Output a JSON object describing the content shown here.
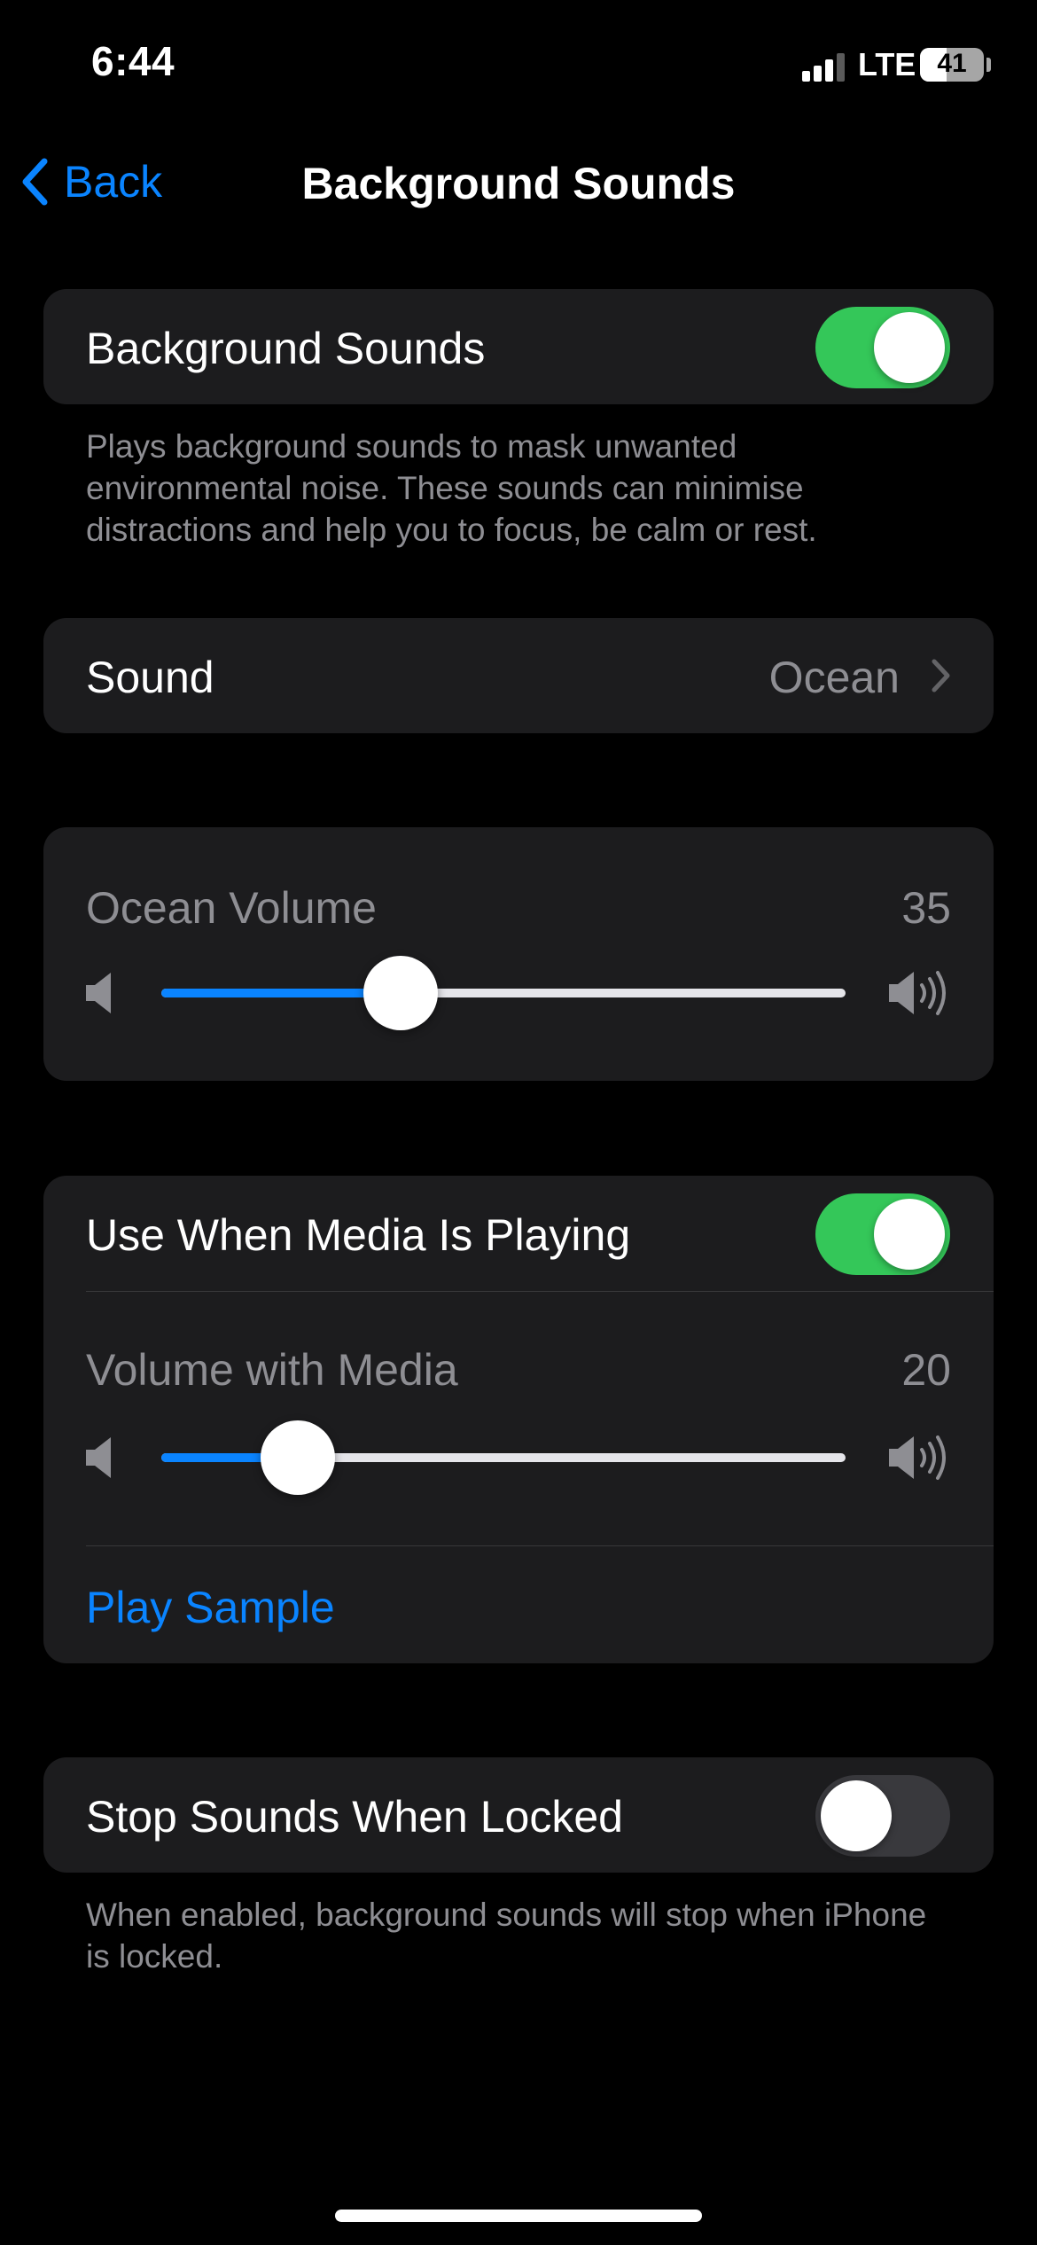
{
  "status_bar": {
    "time": "6:44",
    "network": "LTE",
    "battery": "41",
    "battery_level": 0.41
  },
  "nav": {
    "back_label": "Back",
    "title": "Background Sounds"
  },
  "main_toggle": {
    "label": "Background Sounds",
    "on": true
  },
  "main_footer": "Plays background sounds to mask unwanted environmental noise. These sounds can minimise distractions and help you to focus, be calm or rest.",
  "sound_row": {
    "label": "Sound",
    "value": "Ocean"
  },
  "ocean_volume": {
    "label": "Ocean Volume",
    "value": "35",
    "level": 0.35
  },
  "media_group": {
    "toggle_label": "Use When Media Is Playing",
    "toggle_on": true,
    "volume_label": "Volume with Media",
    "volume_value": "20",
    "volume_level": 0.2,
    "play_sample_label": "Play Sample"
  },
  "lock_toggle": {
    "label": "Stop Sounds When Locked",
    "on": false
  },
  "lock_footer": "When enabled, background sounds will stop when iPhone is locked.",
  "colors": {
    "accent": "#0a84ff",
    "toggle_on": "#34c759",
    "cell": "#1c1c1e"
  }
}
